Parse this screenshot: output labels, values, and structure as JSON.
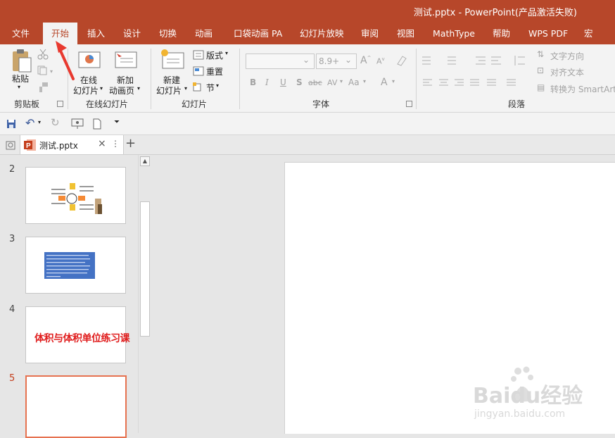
{
  "window": {
    "title": "测试.pptx  -  PowerPoint(产品激活失败)"
  },
  "ribbon_tabs": [
    {
      "label": "文件"
    },
    {
      "label": "开始"
    },
    {
      "label": "插入"
    },
    {
      "label": "设计"
    },
    {
      "label": "切换"
    },
    {
      "label": "动画"
    },
    {
      "label": "口袋动画 PA"
    },
    {
      "label": "幻灯片放映"
    },
    {
      "label": "审阅"
    },
    {
      "label": "视图"
    },
    {
      "label": "MathType"
    },
    {
      "label": "帮助"
    },
    {
      "label": "WPS PDF"
    },
    {
      "label": "宏"
    }
  ],
  "active_tab": "开始",
  "groups": {
    "clipboard": {
      "label": "剪贴板",
      "paste": "粘贴"
    },
    "online_slides": {
      "label": "在线幻灯片",
      "online_1": "在线",
      "online_2": "幻灯片",
      "newpage_1": "新加",
      "newpage_2": "动画页"
    },
    "slides": {
      "label": "幻灯片",
      "new_1": "新建",
      "new_2": "幻灯片",
      "layout": "版式",
      "reset": "重置",
      "section": "节"
    },
    "font": {
      "label": "字体",
      "size": "8.9+",
      "bold": "B",
      "italic": "I",
      "underline": "U",
      "shadow": "S",
      "strike": "abc",
      "spacing": "AV",
      "case": "Aa",
      "color": "A"
    },
    "paragraph": {
      "label": "段落",
      "text_direction": "文字方向",
      "align_text": "对齐文本",
      "smartart": "转换为 SmartArt"
    }
  },
  "document_tab": {
    "name": "测试.pptx",
    "icon_letter": "P",
    "close_glyph": "×",
    "menu_glyph": "⋮",
    "add_glyph": "+"
  },
  "slides": [
    {
      "number": "2"
    },
    {
      "number": "3"
    },
    {
      "number": "4",
      "title": "体积与体积单位练习课"
    },
    {
      "number": "5"
    }
  ],
  "current_slide": "5",
  "watermark": {
    "main": "Baidu经验",
    "sub": "jingyan.baidu.com"
  },
  "colors": {
    "accent": "#b7472a",
    "annotation_arrow": "#e8392f",
    "slide4_text": "#e01d1d",
    "slide3_box": "#4472c4"
  }
}
